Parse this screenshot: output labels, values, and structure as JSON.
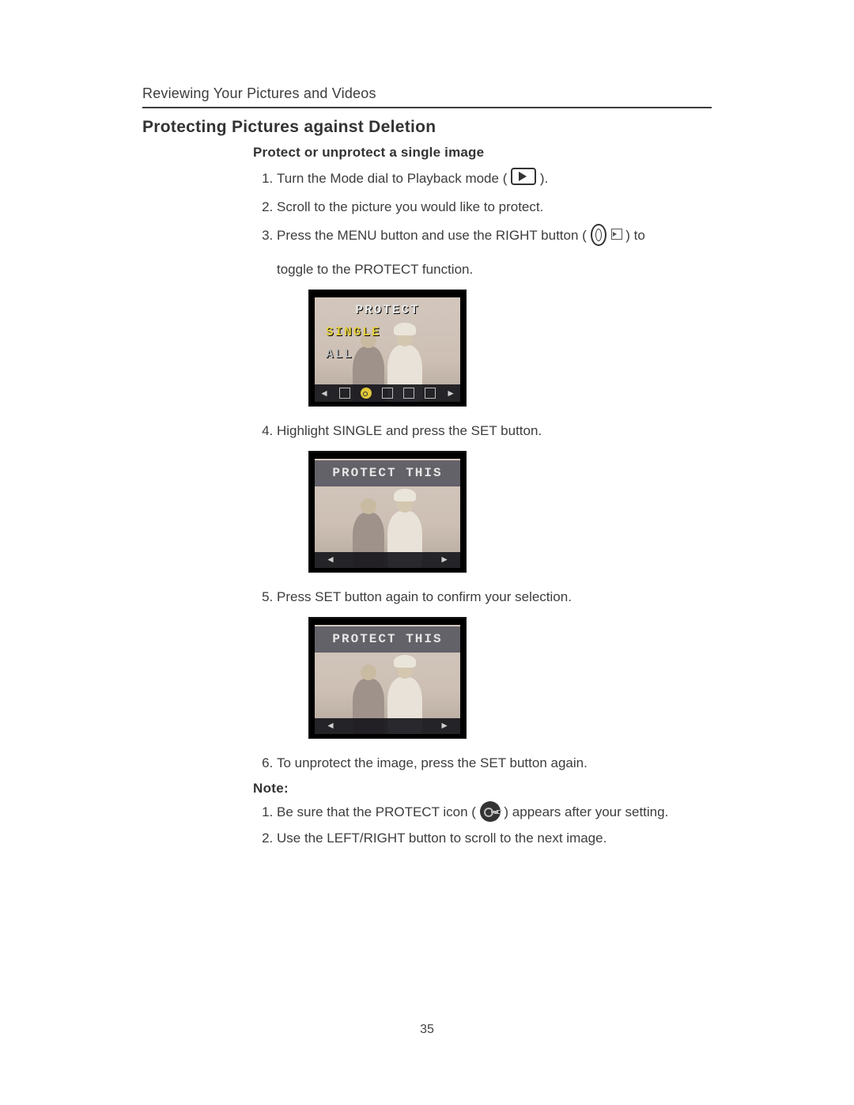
{
  "header": {
    "running": "Reviewing Your Pictures and Videos"
  },
  "title": "Protecting Pictures against Deletion",
  "section": {
    "subhead": "Protect or unprotect a single image"
  },
  "steps": {
    "s1a": "Turn the Mode dial to Playback mode ( ",
    "s1b": " ).",
    "s2": "Scroll to the picture you would like to protect.",
    "s3a": "Press the MENU button and use the RIGHT button ( ",
    "s3b": " ) to",
    "s3c": "toggle to the PROTECT function.",
    "s4": "Highlight SINGLE and press the SET button.",
    "s5": "Press SET button again to confirm your selection.",
    "s6": "To unprotect the image, press the SET button again."
  },
  "note": {
    "label": "Note:",
    "n1a": "Be sure that the PROTECT icon ( ",
    "n1b": " ) appears after your setting.",
    "n2": "Use the LEFT/RIGHT button to scroll to the next image."
  },
  "lcd1": {
    "t1": "PROTECT",
    "t2": "SINGLE",
    "t3": "ALL"
  },
  "lcd2": {
    "band": "PROTECT THIS"
  },
  "lcd3": {
    "band": "PROTECT THIS"
  },
  "page_number": "35"
}
